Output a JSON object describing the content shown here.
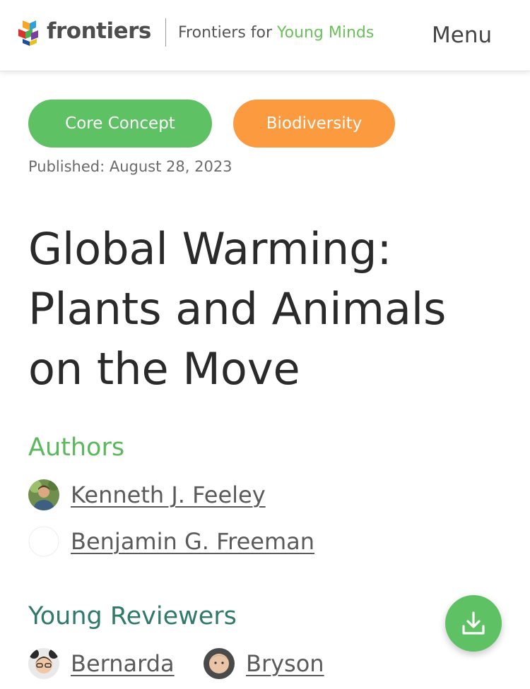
{
  "header": {
    "brand": "frontiers",
    "subbrand_prefix": "Frontiers for ",
    "subbrand_highlight": "Young Minds",
    "menu_label": "Menu"
  },
  "tags": {
    "core": "Core Concept",
    "topic": "Biodiversity"
  },
  "published": "Published: August 28, 2023",
  "article": {
    "title": "Global Warming: Plants and Animals on the Move"
  },
  "authors": {
    "heading": "Authors",
    "items": [
      "Kenneth J. Feeley",
      "Benjamin G. Freeman"
    ]
  },
  "reviewers": {
    "heading": "Young Reviewers",
    "items": [
      "Bernarda",
      "Bryson"
    ]
  },
  "icons": {
    "logo": "frontiers-logo-icon",
    "download": "download-icon"
  },
  "colors": {
    "green": "#5ec164",
    "orange": "#fb9a3f",
    "teal": "#2f7a6b"
  }
}
